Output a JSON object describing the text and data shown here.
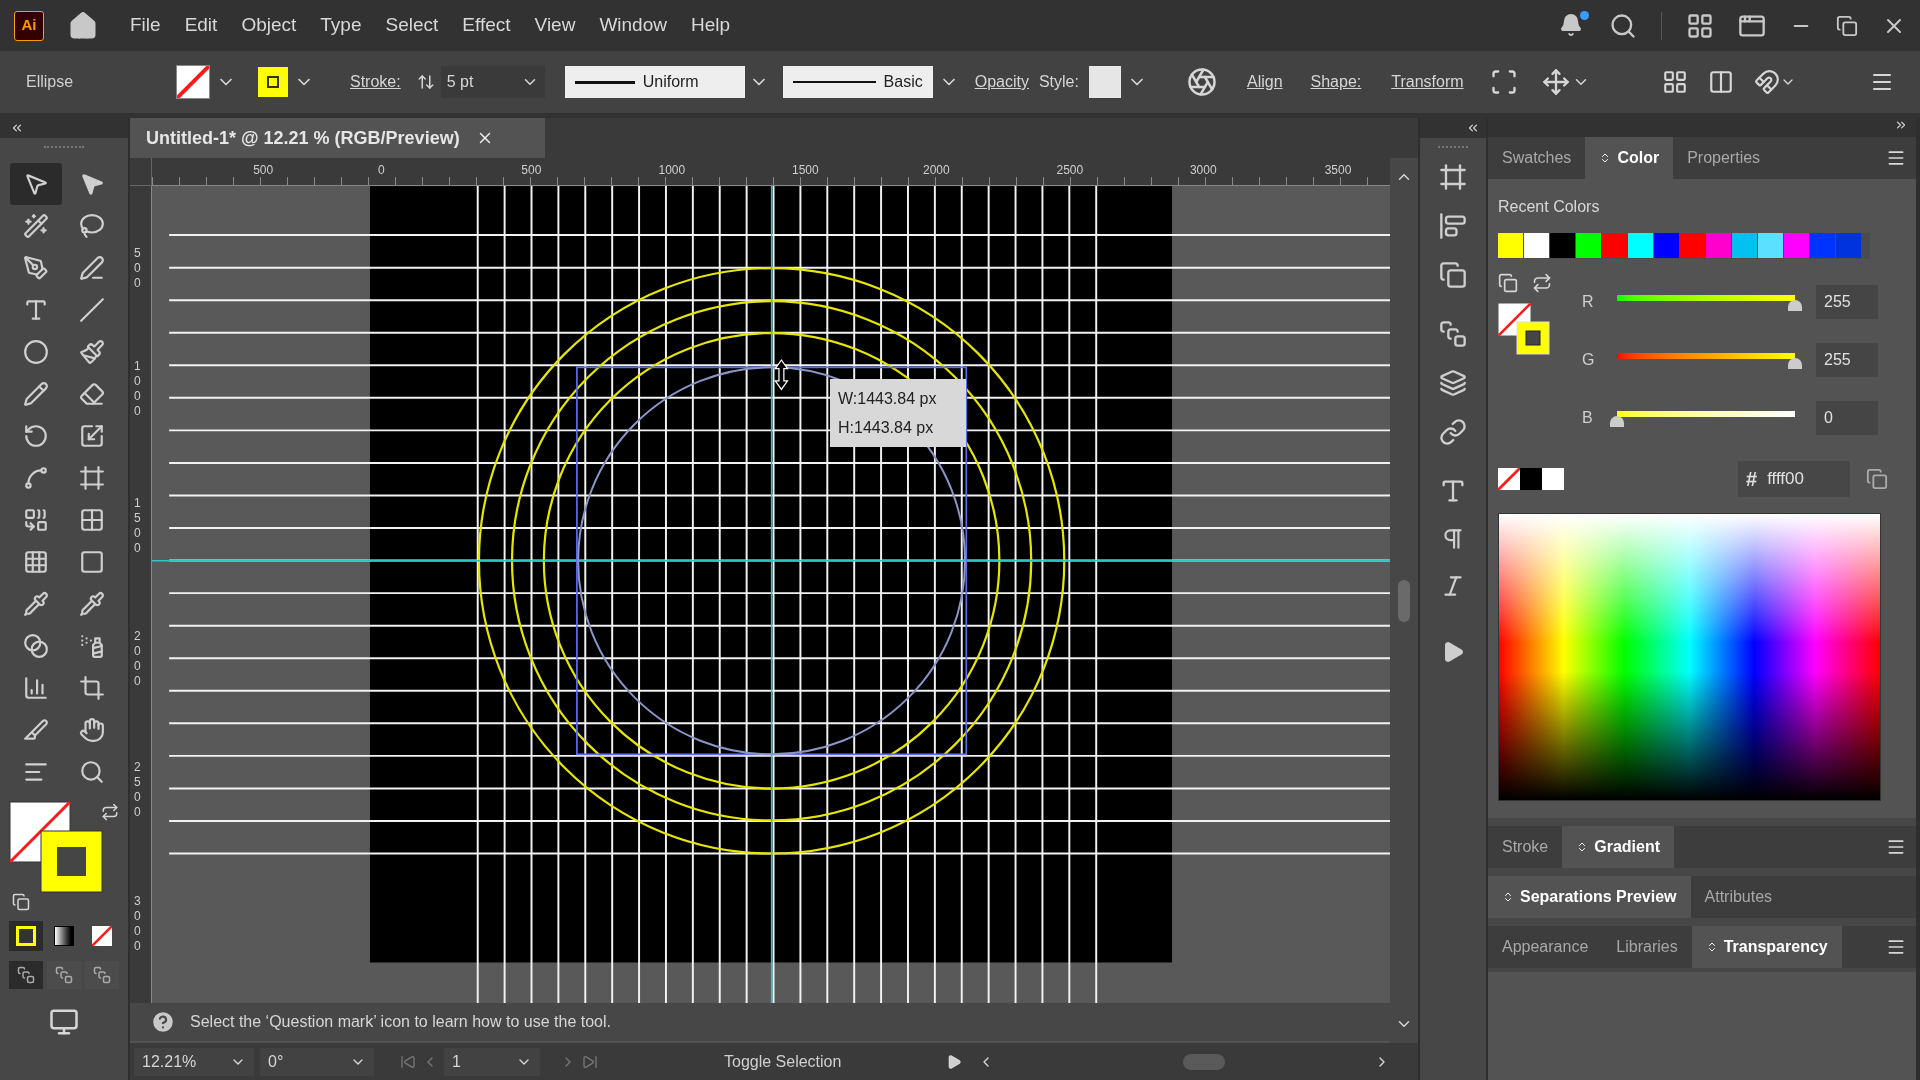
{
  "app_logo": "Ai",
  "menu": [
    "File",
    "Edit",
    "Object",
    "Type",
    "Select",
    "Effect",
    "View",
    "Window",
    "Help"
  ],
  "control_bar": {
    "object_type": "Ellipse",
    "stroke_label": "Stroke:",
    "stroke_weight": "5 pt",
    "variable_width_profile": "Uniform",
    "brush": "Basic",
    "opacity_label": "Opacity",
    "style_label": "Style:",
    "align_label": "Align",
    "shape_label": "Shape:",
    "transform_label": "Transform"
  },
  "document_tab": {
    "title": "Untitled-1* @ 12.21 % (RGB/Preview)"
  },
  "tools": [
    {
      "selected": true
    },
    {
      "selected": false
    },
    {
      "selected": false
    },
    {
      "selected": false
    },
    {
      "selected": false
    },
    {
      "selected": false
    },
    {
      "selected": false
    },
    {
      "selected": false
    },
    {
      "selected": false
    },
    {
      "selected": false
    },
    {
      "selected": false
    },
    {
      "selected": false
    },
    {
      "selected": false
    },
    {
      "selected": false
    },
    {
      "selected": false
    },
    {
      "selected": false
    },
    {
      "selected": false
    },
    {
      "selected": false
    },
    {
      "selected": false
    },
    {
      "selected": false
    },
    {
      "selected": false
    },
    {
      "selected": false
    },
    {
      "selected": false
    },
    {
      "selected": false
    },
    {
      "selected": false
    },
    {
      "selected": false
    },
    {
      "selected": false
    },
    {
      "selected": false
    },
    {
      "selected": false
    },
    {
      "selected": false
    }
  ],
  "fill_modes": [
    {
      "selected": true
    },
    {
      "selected": false
    },
    {
      "selected": false
    }
  ],
  "draw_modes": [
    {
      "selected": true
    },
    {
      "selected": false
    },
    {
      "selected": false
    }
  ],
  "horizontal_ruler": [
    "500",
    "0",
    "500",
    "1000",
    "1500",
    "2000",
    "2500",
    "3000",
    "3500"
  ],
  "vertical_ruler": [
    "500",
    "1000",
    "1500",
    "2000",
    "2500",
    "3000"
  ],
  "tooltip": {
    "lines": [
      "W:1443.84 px",
      "H:1443.84 px"
    ]
  },
  "status_message": "Select the ‘Question mark’ icon to learn how to use the tool.",
  "bottom_bar": {
    "zoom": "12.21%",
    "rotation": "0°",
    "artboard": "1",
    "action": "Toggle Selection"
  },
  "color_panel": {
    "tabs": [
      {
        "label": "Swatches",
        "selected": false
      },
      {
        "label": "Color",
        "selected": true
      },
      {
        "label": "Properties",
        "selected": false
      }
    ],
    "recent_colors_label": "Recent Colors",
    "recent_colors": [
      {
        "color": "#ffff00"
      },
      {
        "color": "#ffffff"
      },
      {
        "color": "#000000"
      },
      {
        "color": "#00ff00"
      },
      {
        "color": "#ff0000"
      },
      {
        "color": "#00ffff"
      },
      {
        "color": "#0000ff"
      },
      {
        "color": "#ff0000"
      },
      {
        "color": "#ff00cc"
      },
      {
        "color": "#00c0f0"
      },
      {
        "color": "#5ce0ff"
      },
      {
        "color": "#ff00ff"
      },
      {
        "color": "#0033ff"
      },
      {
        "color": "#0033dd"
      }
    ],
    "channels": [
      {
        "name": "R",
        "level": 1,
        "value": "255"
      },
      {
        "name": "G",
        "level": 1,
        "value": "255"
      },
      {
        "name": "B",
        "level": 0,
        "value": "0"
      }
    ],
    "hex_label": "#",
    "hex_value": "ffff00"
  },
  "panel_groups": [
    {
      "tabs": [
        {
          "label": "Stroke",
          "selected": false
        },
        {
          "label": "Gradient",
          "selected": true
        }
      ]
    },
    {
      "tabs": [
        {
          "label": "Separations Preview",
          "selected": true
        },
        {
          "label": "Attributes",
          "selected": false
        }
      ]
    },
    {
      "tabs": [
        {
          "label": "Appearance",
          "selected": false
        },
        {
          "label": "Libraries",
          "selected": false
        },
        {
          "label": "Transparency",
          "selected": true
        }
      ]
    }
  ]
}
